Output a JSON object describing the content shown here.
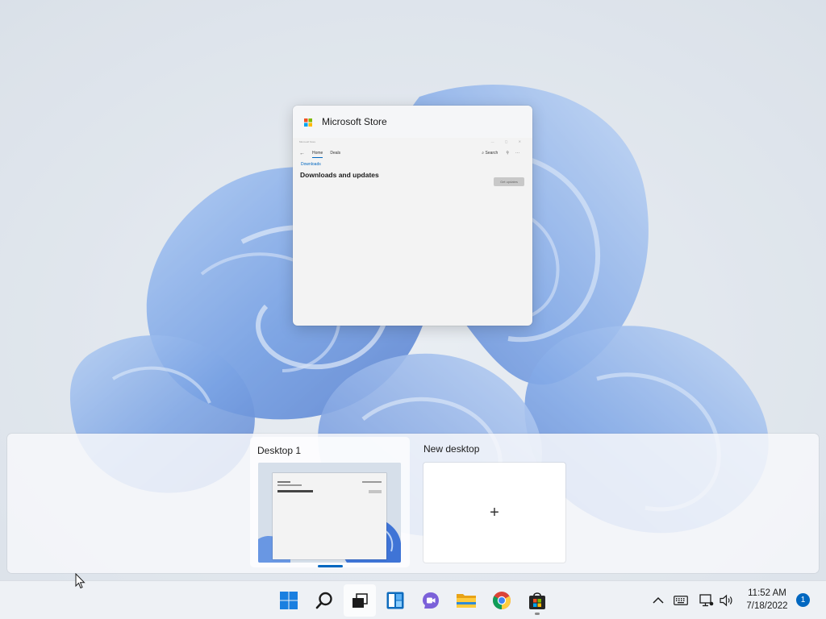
{
  "window_card": {
    "title": "Microsoft Store",
    "app": {
      "titlebar": "Microsoft Store",
      "tabs": [
        "Home",
        "Deals"
      ],
      "search": "Search",
      "breadcrumb": "Downloads",
      "heading": "Downloads and updates",
      "get_updates_button": "Get updates"
    }
  },
  "desktops": {
    "desktop1_label": "Desktop 1",
    "new_desktop_label": "New desktop",
    "new_desktop_plus": "+"
  },
  "taskbar": {
    "icons": [
      "start-icon",
      "search-icon",
      "task-view-icon",
      "widgets-icon",
      "chat-icon",
      "file-explorer-icon",
      "chrome-icon",
      "microsoft-store-icon"
    ],
    "tray": {
      "chevron": "^",
      "time": "11:52 AM",
      "date": "7/18/2022",
      "notification_count": "1"
    }
  },
  "colors": {
    "accent": "#0067c0",
    "taskbar": "#eef1f5",
    "wallpaper_bg": "#dfe5ec",
    "bloom": "#4a7fd8"
  }
}
